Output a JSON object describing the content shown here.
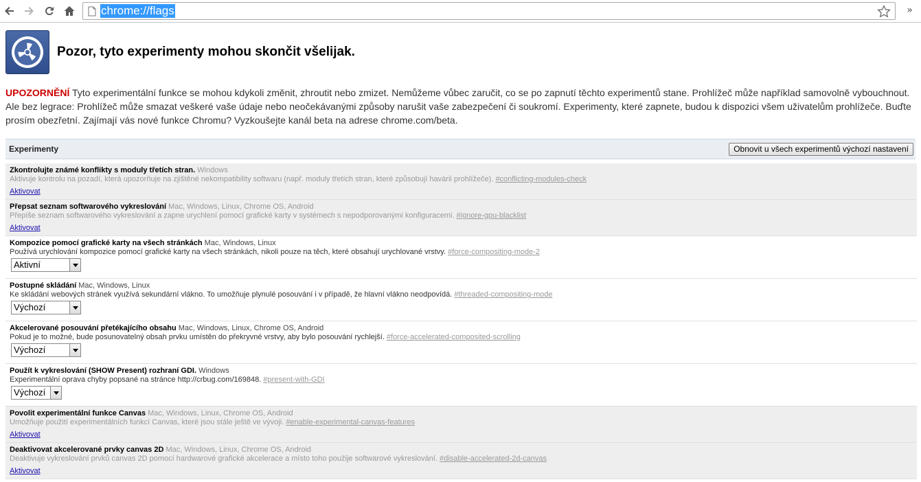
{
  "toolbar": {
    "url": "chrome://flags",
    "back_icon": "back-arrow-icon",
    "forward_icon": "forward-arrow-icon",
    "reload_icon": "reload-icon",
    "home_icon": "home-icon",
    "star_icon": "bookmark-star-icon",
    "overflow": "»"
  },
  "header": {
    "logo_icon": "radiation-warning-icon",
    "title": "Pozor, tyto experimenty mohou skončit všelijak."
  },
  "warning": {
    "label": "UPOZORNĚNÍ",
    "text": " Tyto experimentální funkce se mohou kdykoli změnit, zhroutit nebo zmizet. Nemůžeme vůbec zaručit, co se po zapnutí těchto experimentů stane. Prohlížeč může například samovolně vybouchnout. Ale bez legrace: Prohlížeč může smazat veškeré vaše údaje nebo neočekávanými způsoby narušit vaše zabezpečení či soukromí. Experimenty, které zapnete, budou k dispozici všem uživatelům prohlížeče. Buďte prosím obezřetní. Zajímají vás nové funkce Chromu? Vyzkoušejte kanál beta na adrese chrome.com/beta."
  },
  "experiments": {
    "title": "Experimenty",
    "reset_label": "Obnovit u všech experimentů výchozí nastavení",
    "items": [
      {
        "name": "Zkontrolujte známé konflikty s moduly třetích stran.",
        "platforms": "Windows",
        "description": "Aktivuje kontrolu na pozadí, která upozorňuje na zjištěné nekompatibility softwaru (např. moduly třetích stran, které způsobují havárii prohlížeče).",
        "anchor": "#conflicting-modules-check",
        "action": "Aktivovat"
      },
      {
        "name": "Přepsat seznam softwarového vykreslování",
        "platforms": "Mac, Windows, Linux, Chrome OS, Android",
        "description": "Přepíše seznam softwarového vykreslování a zapne urychlení pomocí grafické karty v systémech s nepodporovanými konfiguracemi.",
        "anchor": "#ignore-gpu-blacklist",
        "action": "Aktivovat"
      },
      {
        "name": "Kompozice pomocí grafické karty na všech stránkách",
        "platforms": "Mac, Windows, Linux",
        "description": "Používá urychlování kompozice pomocí grafické karty na všech stránkách, nikoli pouze na těch, které obsahují urychlované vrstvy.",
        "anchor": "#force-compositing-mode-2",
        "select": "Aktivní"
      },
      {
        "name": "Postupné skládání",
        "platforms": "Mac, Windows, Linux",
        "description": "Ke skládání webových stránek využívá sekundární vlákno. To umožňuje plynulé posouvání i v případě, že hlavní vlákno neodpovídá.",
        "anchor": "#threaded-compositing-mode",
        "select": "Výchozí"
      },
      {
        "name": "Akcelerované posouvání přetékajícího obsahu",
        "platforms": "Mac, Windows, Linux, Chrome OS, Android",
        "description": "Pokud je to možné, bude posunovatelný obsah prvku umístěn do překryvné vrstvy, aby bylo posouvání rychlejší.",
        "anchor": "#force-accelerated-composited-scrolling",
        "select": "Výchozí"
      },
      {
        "name": "Použít k vykreslování (SHOW Present) rozhraní GDI.",
        "platforms": "Windows",
        "description": "Experimentální oprava chyby popsané na stránce http://crbug.com/169848.",
        "anchor": "#present-with-GDI",
        "select": "Výchozí"
      },
      {
        "name": "Povolit experimentální funkce Canvas",
        "platforms": "Mac, Windows, Linux, Chrome OS, Android",
        "description": "Umožňuje použití experimentálních funkcí Canvas, které jsou stále ještě ve vývoji.",
        "anchor": "#enable-experimental-canvas-features",
        "action": "Aktivovat"
      },
      {
        "name": "Deaktivovat akcelerované prvky canvas 2D",
        "platforms": "Mac, Windows, Linux, Chrome OS, Android",
        "description": "Deaktivuje vykreslování prvků canvas 2D pomocí hardwarové grafické akcelerace a místo toho použije softwarové vykreslování.",
        "anchor": "#disable-accelerated-2d-canvas",
        "action": "Aktivovat"
      }
    ]
  }
}
